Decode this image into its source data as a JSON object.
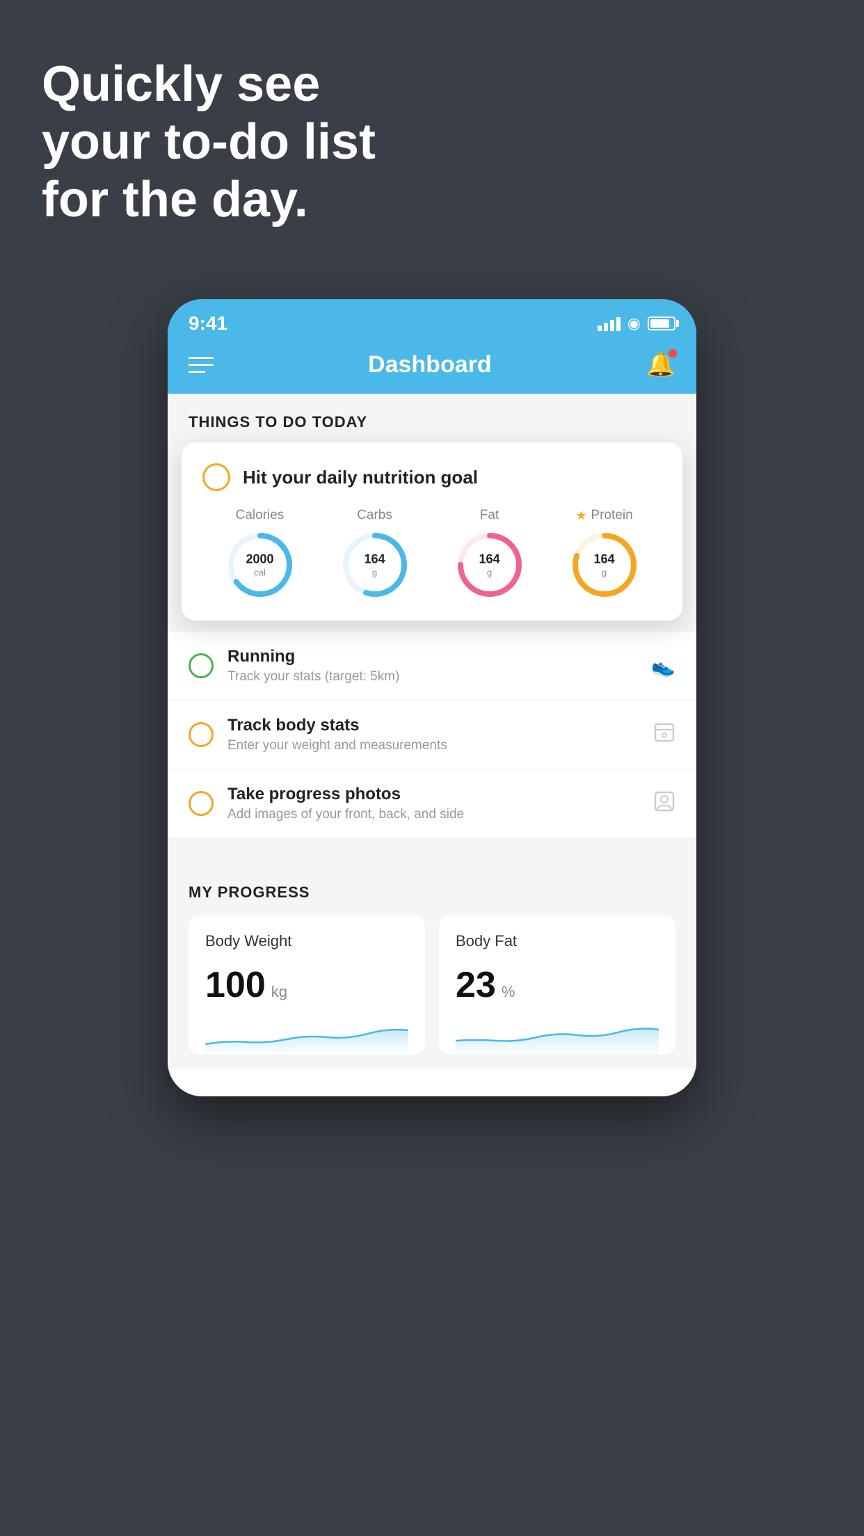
{
  "hero": {
    "line1": "Quickly see",
    "line2": "your to-do list",
    "line3": "for the day."
  },
  "status_bar": {
    "time": "9:41",
    "signal": "signal",
    "wifi": "wifi",
    "battery": "battery"
  },
  "header": {
    "title": "Dashboard",
    "menu_label": "menu",
    "bell_label": "notifications"
  },
  "things_to_do": {
    "section_title": "THINGS TO DO TODAY",
    "nutrition_card": {
      "title": "Hit your daily nutrition goal",
      "macros": [
        {
          "label": "Calories",
          "value": "2000",
          "unit": "cal",
          "color": "#4ab8e8",
          "progress": 65
        },
        {
          "label": "Carbs",
          "value": "164",
          "unit": "g",
          "color": "#4ab8e8",
          "progress": 55
        },
        {
          "label": "Fat",
          "value": "164",
          "unit": "g",
          "color": "#f06292",
          "progress": 75
        },
        {
          "label": "Protein",
          "value": "164",
          "unit": "g",
          "color": "#f5a623",
          "progress": 80,
          "starred": true
        }
      ]
    },
    "todo_items": [
      {
        "id": "running",
        "title": "Running",
        "subtitle": "Track your stats (target: 5km)",
        "circle_color": "green",
        "icon": "shoe"
      },
      {
        "id": "body-stats",
        "title": "Track body stats",
        "subtitle": "Enter your weight and measurements",
        "circle_color": "yellow",
        "icon": "scale"
      },
      {
        "id": "progress-photos",
        "title": "Take progress photos",
        "subtitle": "Add images of your front, back, and side",
        "circle_color": "yellow",
        "icon": "person"
      }
    ]
  },
  "my_progress": {
    "section_title": "MY PROGRESS",
    "cards": [
      {
        "id": "body-weight",
        "title": "Body Weight",
        "value": "100",
        "unit": "kg"
      },
      {
        "id": "body-fat",
        "title": "Body Fat",
        "value": "23",
        "unit": "%"
      }
    ]
  }
}
